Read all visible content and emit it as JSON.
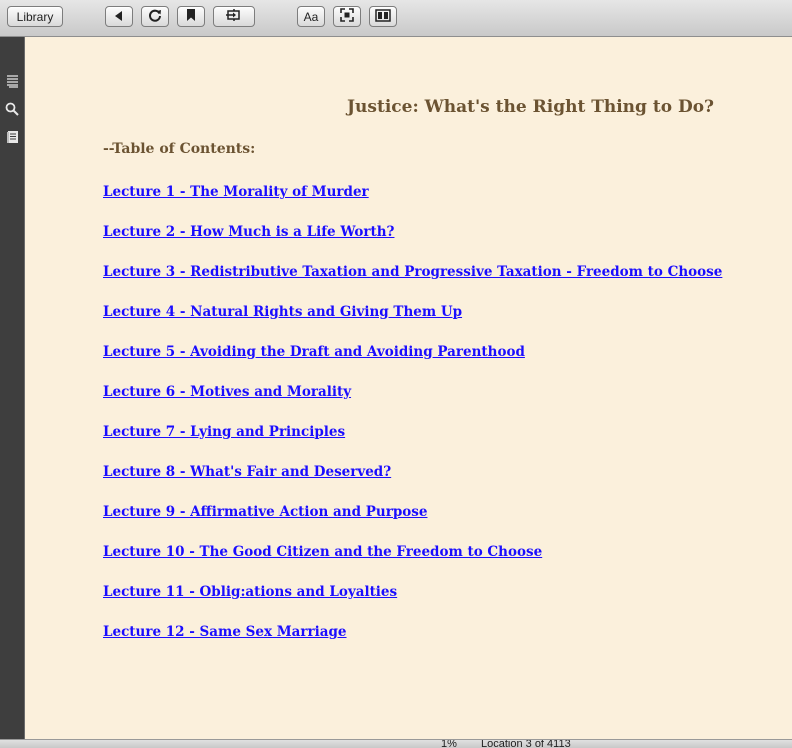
{
  "toolbar": {
    "library_label": "Library",
    "buttons": [
      "back-icon",
      "sync-icon",
      "bookmark-icon",
      "go-to-icon",
      "font-settings-icon",
      "fullscreen-icon",
      "two-page-view-icon"
    ],
    "font_label": "Aa"
  },
  "sidebar": {
    "icons": [
      "toc-list-icon",
      "search-icon",
      "notes-icon"
    ]
  },
  "book": {
    "title": "Justice: What's the Right Thing to Do?",
    "toc_heading": "--Table of Contents:",
    "lectures": [
      "Lecture 1 - The Morality of Murder",
      "Lecture 2 - How Much is a Life Worth?",
      "Lecture 3 - Redistributive Taxation and Progressive Taxation - Freedom to Choose",
      "Lecture 4 - Natural Rights and Giving Them Up",
      "Lecture 5 - Avoiding the Draft and Avoiding Parenthood",
      "Lecture 6 - Motives and Morality",
      "Lecture 7 - Lying and Principles",
      "Lecture 8 - What's Fair and Deserved?",
      "Lecture 9 - Affirmative Action and Purpose",
      "Lecture 10 - The Good Citizen and the Freedom to Choose",
      "Lecture 11 - Oblig:ations and Loyalties",
      "Lecture 12 - Same Sex Marriage"
    ]
  },
  "status": {
    "progress": "1%",
    "location": "Location 3 of 4113"
  },
  "colors": {
    "page_bg": "#fbf0dc",
    "title_color": "#6b5332",
    "link_color": "#1a0dff",
    "sidebar_bg": "#3e3e3e"
  }
}
